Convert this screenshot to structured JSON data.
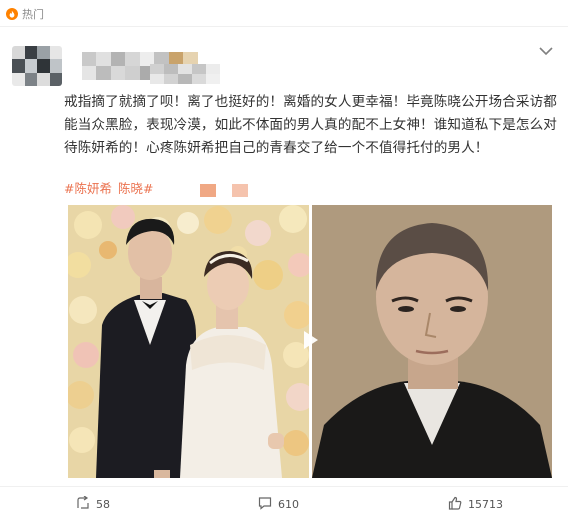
{
  "hot": {
    "label": "热门",
    "icon": "fire-icon"
  },
  "post": {
    "text": "戒指摘了就摘了呗！离了也挺好的！离婚的女人更幸福！毕竟陈晓公开场合采访都能当众黑脸，表现冷漠，如此不体面的男人真的配不上女神！谁知道私下是怎么对待陈妍希的！心疼陈妍希把自己的青春交了给一个不值得托付的男人！",
    "tags": [
      "#陈妍希",
      "陈晓#"
    ]
  },
  "media": {
    "left_photo": "wedding-photo",
    "right_photo": "portrait-photo",
    "play_icon": "play-icon"
  },
  "actions": {
    "repost": {
      "icon": "repost-icon",
      "count": "58"
    },
    "comment": {
      "icon": "comment-icon",
      "count": "610"
    },
    "like": {
      "icon": "thumbs-up-icon",
      "count": "15713"
    }
  },
  "colors": {
    "accent": "#ff8200",
    "tag": "#eb7350",
    "text": "#333333",
    "muted": "#8a8a8a"
  }
}
